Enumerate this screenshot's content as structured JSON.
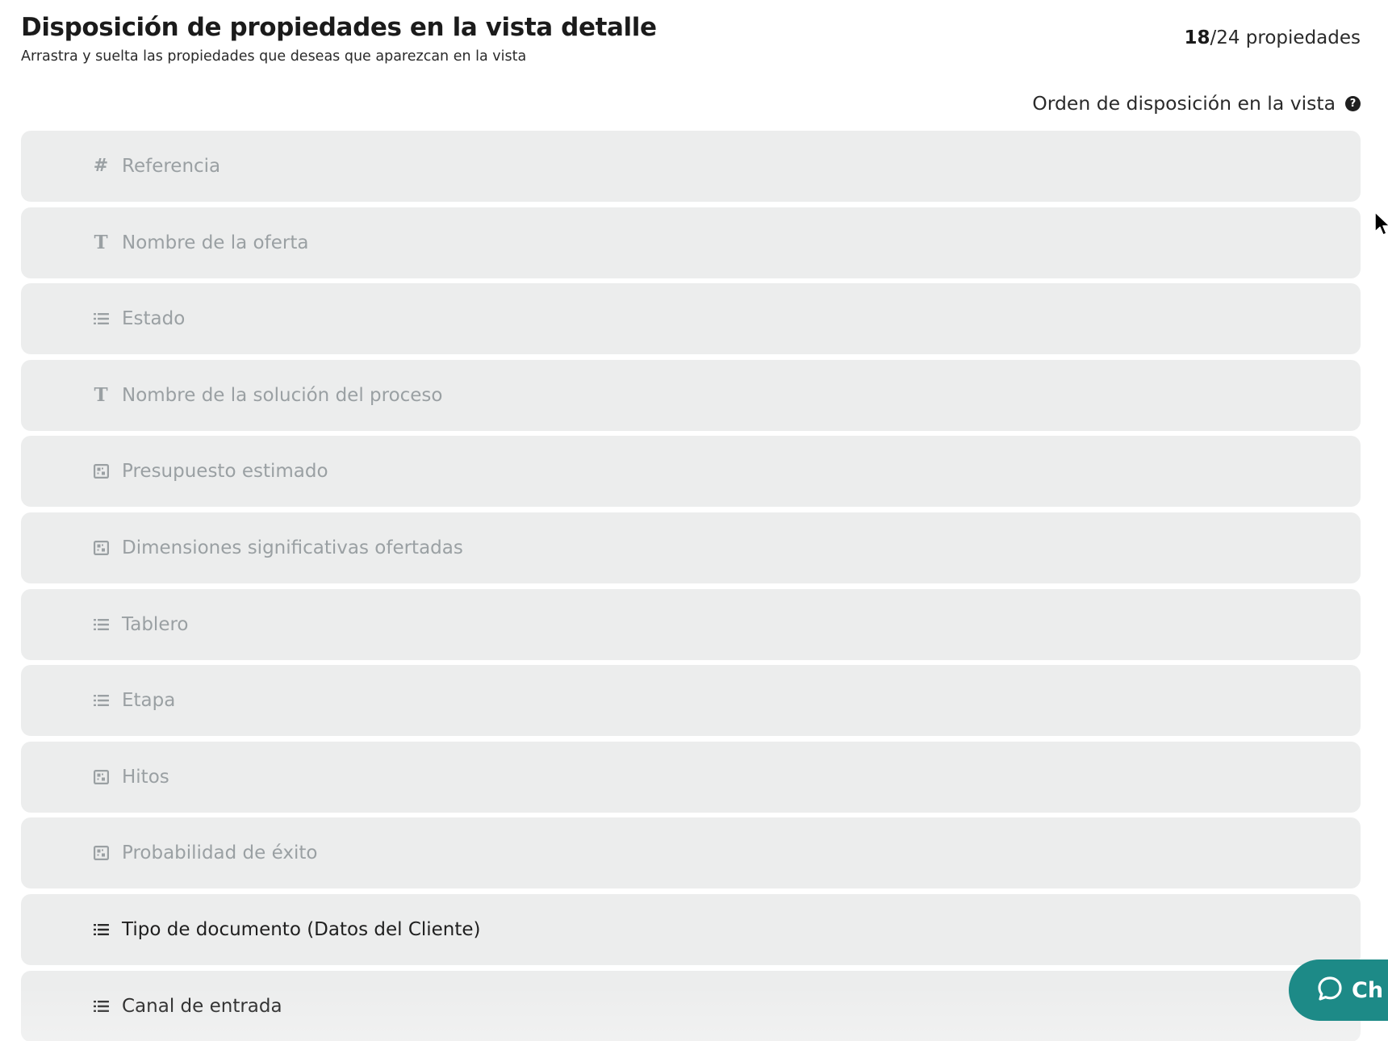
{
  "header": {
    "title": "Disposición de propiedades en la vista detalle",
    "subtitle": "Arrastra y suelta las propiedades que deseas que aparezcan en la vista",
    "counter_selected": "18",
    "counter_total": "/24 propiedades"
  },
  "order": {
    "label": "Orden de disposición en la vista",
    "help_icon": "question-circle-icon"
  },
  "properties": [
    {
      "label": "Referencia",
      "icon": "hash-icon",
      "active": false
    },
    {
      "label": "Nombre de la oferta",
      "icon": "text-icon",
      "active": false
    },
    {
      "label": "Estado",
      "icon": "list-icon",
      "active": false
    },
    {
      "label": "Nombre de la solución del proceso",
      "icon": "text-icon",
      "active": false
    },
    {
      "label": "Presupuesto estimado",
      "icon": "number-field-icon",
      "active": false
    },
    {
      "label": "Dimensiones significativas ofertadas",
      "icon": "number-field-icon",
      "active": false
    },
    {
      "label": "Tablero",
      "icon": "list-icon",
      "active": false
    },
    {
      "label": "Etapa",
      "icon": "list-icon",
      "active": false
    },
    {
      "label": "Hitos",
      "icon": "number-field-icon",
      "active": false
    },
    {
      "label": "Probabilidad de éxito",
      "icon": "number-field-icon",
      "active": false
    },
    {
      "label": "Tipo de documento (Datos del Cliente)",
      "icon": "list-icon",
      "active": true
    },
    {
      "label": "Canal de entrada",
      "icon": "list-icon",
      "active": true
    }
  ],
  "chat": {
    "label": "Ch",
    "icon": "chat-bubble-icon",
    "color": "#1d8a87"
  },
  "colors": {
    "row_background": "#eceded",
    "inactive_text": "#9aa0a3",
    "active_text": "#1f1f1f"
  }
}
